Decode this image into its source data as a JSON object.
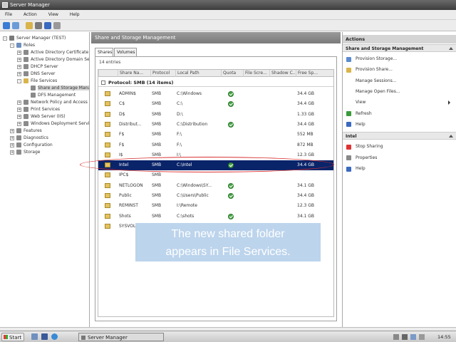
{
  "window": {
    "title": "Server Manager"
  },
  "menu": [
    "File",
    "Action",
    "View",
    "Help"
  ],
  "tree": [
    {
      "label": "Server Manager (TEST)",
      "indent": 0,
      "exp": "-",
      "color": "#7a7a7a"
    },
    {
      "label": "Roles",
      "indent": 1,
      "exp": "-",
      "color": "#6f8fbf"
    },
    {
      "label": "Active Directory Certificate",
      "indent": 2,
      "exp": "+",
      "color": "#8a8a8a"
    },
    {
      "label": "Active Directory Domain Se",
      "indent": 2,
      "exp": "+",
      "color": "#8a8a8a"
    },
    {
      "label": "DHCP Server",
      "indent": 2,
      "exp": "+",
      "color": "#8a8a8a"
    },
    {
      "label": "DNS Server",
      "indent": 2,
      "exp": "+",
      "color": "#8a8a8a"
    },
    {
      "label": "File Services",
      "indent": 2,
      "exp": "-",
      "color": "#d9b44a"
    },
    {
      "label": "Share and Storage Mana",
      "indent": 3,
      "exp": "",
      "color": "#8a8a8a",
      "selected": true
    },
    {
      "label": "DFS Management",
      "indent": 3,
      "exp": "",
      "color": "#8a8a8a"
    },
    {
      "label": "Network Policy and Access",
      "indent": 2,
      "exp": "+",
      "color": "#8a8a8a"
    },
    {
      "label": "Print Services",
      "indent": 2,
      "exp": "+",
      "color": "#8a8a8a"
    },
    {
      "label": "Web Server (IIS)",
      "indent": 2,
      "exp": "+",
      "color": "#8a8a8a"
    },
    {
      "label": "Windows Deployment Servi",
      "indent": 2,
      "exp": "+",
      "color": "#8a8a8a"
    },
    {
      "label": "Features",
      "indent": 1,
      "exp": "+",
      "color": "#8a8a8a"
    },
    {
      "label": "Diagnostics",
      "indent": 1,
      "exp": "+",
      "color": "#8a8a8a"
    },
    {
      "label": "Configuration",
      "indent": 1,
      "exp": "+",
      "color": "#8a8a8a"
    },
    {
      "label": "Storage",
      "indent": 1,
      "exp": "+",
      "color": "#8a8a8a"
    }
  ],
  "center": {
    "title": "Share and Storage Management",
    "tabs": [
      "Shares",
      "Volumes"
    ],
    "count": "14 entries",
    "columns": [
      "",
      "Share Na...",
      "Protocol",
      "Local Path",
      "Quota",
      "File Scre...",
      "Shadow C...",
      "Free Sp..."
    ],
    "group": "Protocol: SMB (14 items)",
    "rows": [
      {
        "name": "ADMIN$",
        "protocol": "SMB",
        "path": "C:\\Windows",
        "quota": true,
        "free": "34.4 GB"
      },
      {
        "name": "C$",
        "protocol": "SMB",
        "path": "C:\\",
        "quota": true,
        "free": "34.4 GB"
      },
      {
        "name": "D$",
        "protocol": "SMB",
        "path": "D:\\",
        "quota": false,
        "free": "1.33 GB"
      },
      {
        "name": "Distribut...",
        "protocol": "SMB",
        "path": "C:\\Distribution",
        "quota": true,
        "free": "34.4 GB"
      },
      {
        "name": "F$",
        "protocol": "SMB",
        "path": "F:\\",
        "quota": false,
        "free": "552 MB"
      },
      {
        "name": "F$",
        "protocol": "SMB",
        "path": "F:\\",
        "quota": false,
        "free": "872 MB"
      },
      {
        "name": "I$",
        "protocol": "SMB",
        "path": "I:\\",
        "quota": false,
        "free": "12.3 GB"
      },
      {
        "name": "Intel",
        "protocol": "SMB",
        "path": "C:\\Intel",
        "quota": true,
        "free": "34.4 GB",
        "selected": true
      },
      {
        "name": "IPC$",
        "protocol": "SMB",
        "path": "",
        "quota": false,
        "free": ""
      },
      {
        "name": "NETLOGON",
        "protocol": "SMB",
        "path": "C:\\Windows\\SY...",
        "quota": true,
        "free": "34.1 GB"
      },
      {
        "name": "Public",
        "protocol": "SMB",
        "path": "C:\\Users\\Public",
        "quota": true,
        "free": "34.4 GB"
      },
      {
        "name": "REMINST",
        "protocol": "SMB",
        "path": "I:\\Remote",
        "quota": false,
        "free": "12.3 GB"
      },
      {
        "name": "Shots",
        "protocol": "SMB",
        "path": "C:\\shots",
        "quota": true,
        "free": "34.1 GB"
      },
      {
        "name": "SYSVOL",
        "protocol": "SMB",
        "path": "",
        "quota": true,
        "free": ""
      }
    ]
  },
  "callout": {
    "line1": "The new shared folder",
    "line2": "appears in File Services."
  },
  "actions": {
    "header": "Actions",
    "section1": "Share and Storage Management",
    "items1": [
      {
        "label": "Provision Storage...",
        "color": "#5a8bd0"
      },
      {
        "label": "Provision Share...",
        "color": "#d9b44a"
      },
      {
        "label": "Manage Sessions...",
        "color": ""
      },
      {
        "label": "Manage Open Files...",
        "color": ""
      },
      {
        "label": "View",
        "color": "",
        "submenu": true
      },
      {
        "label": "Refresh",
        "color": "#3a9a3a"
      },
      {
        "label": "Help",
        "color": "#3a6ac0"
      }
    ],
    "section2": "Intel",
    "items2": [
      {
        "label": "Stop Sharing",
        "color": "#d33"
      },
      {
        "label": "Properties",
        "color": "#888"
      },
      {
        "label": "Help",
        "color": "#3a6ac0"
      }
    ]
  },
  "taskbar": {
    "start": "Start",
    "task": "Server Manager",
    "time": "14:55"
  }
}
